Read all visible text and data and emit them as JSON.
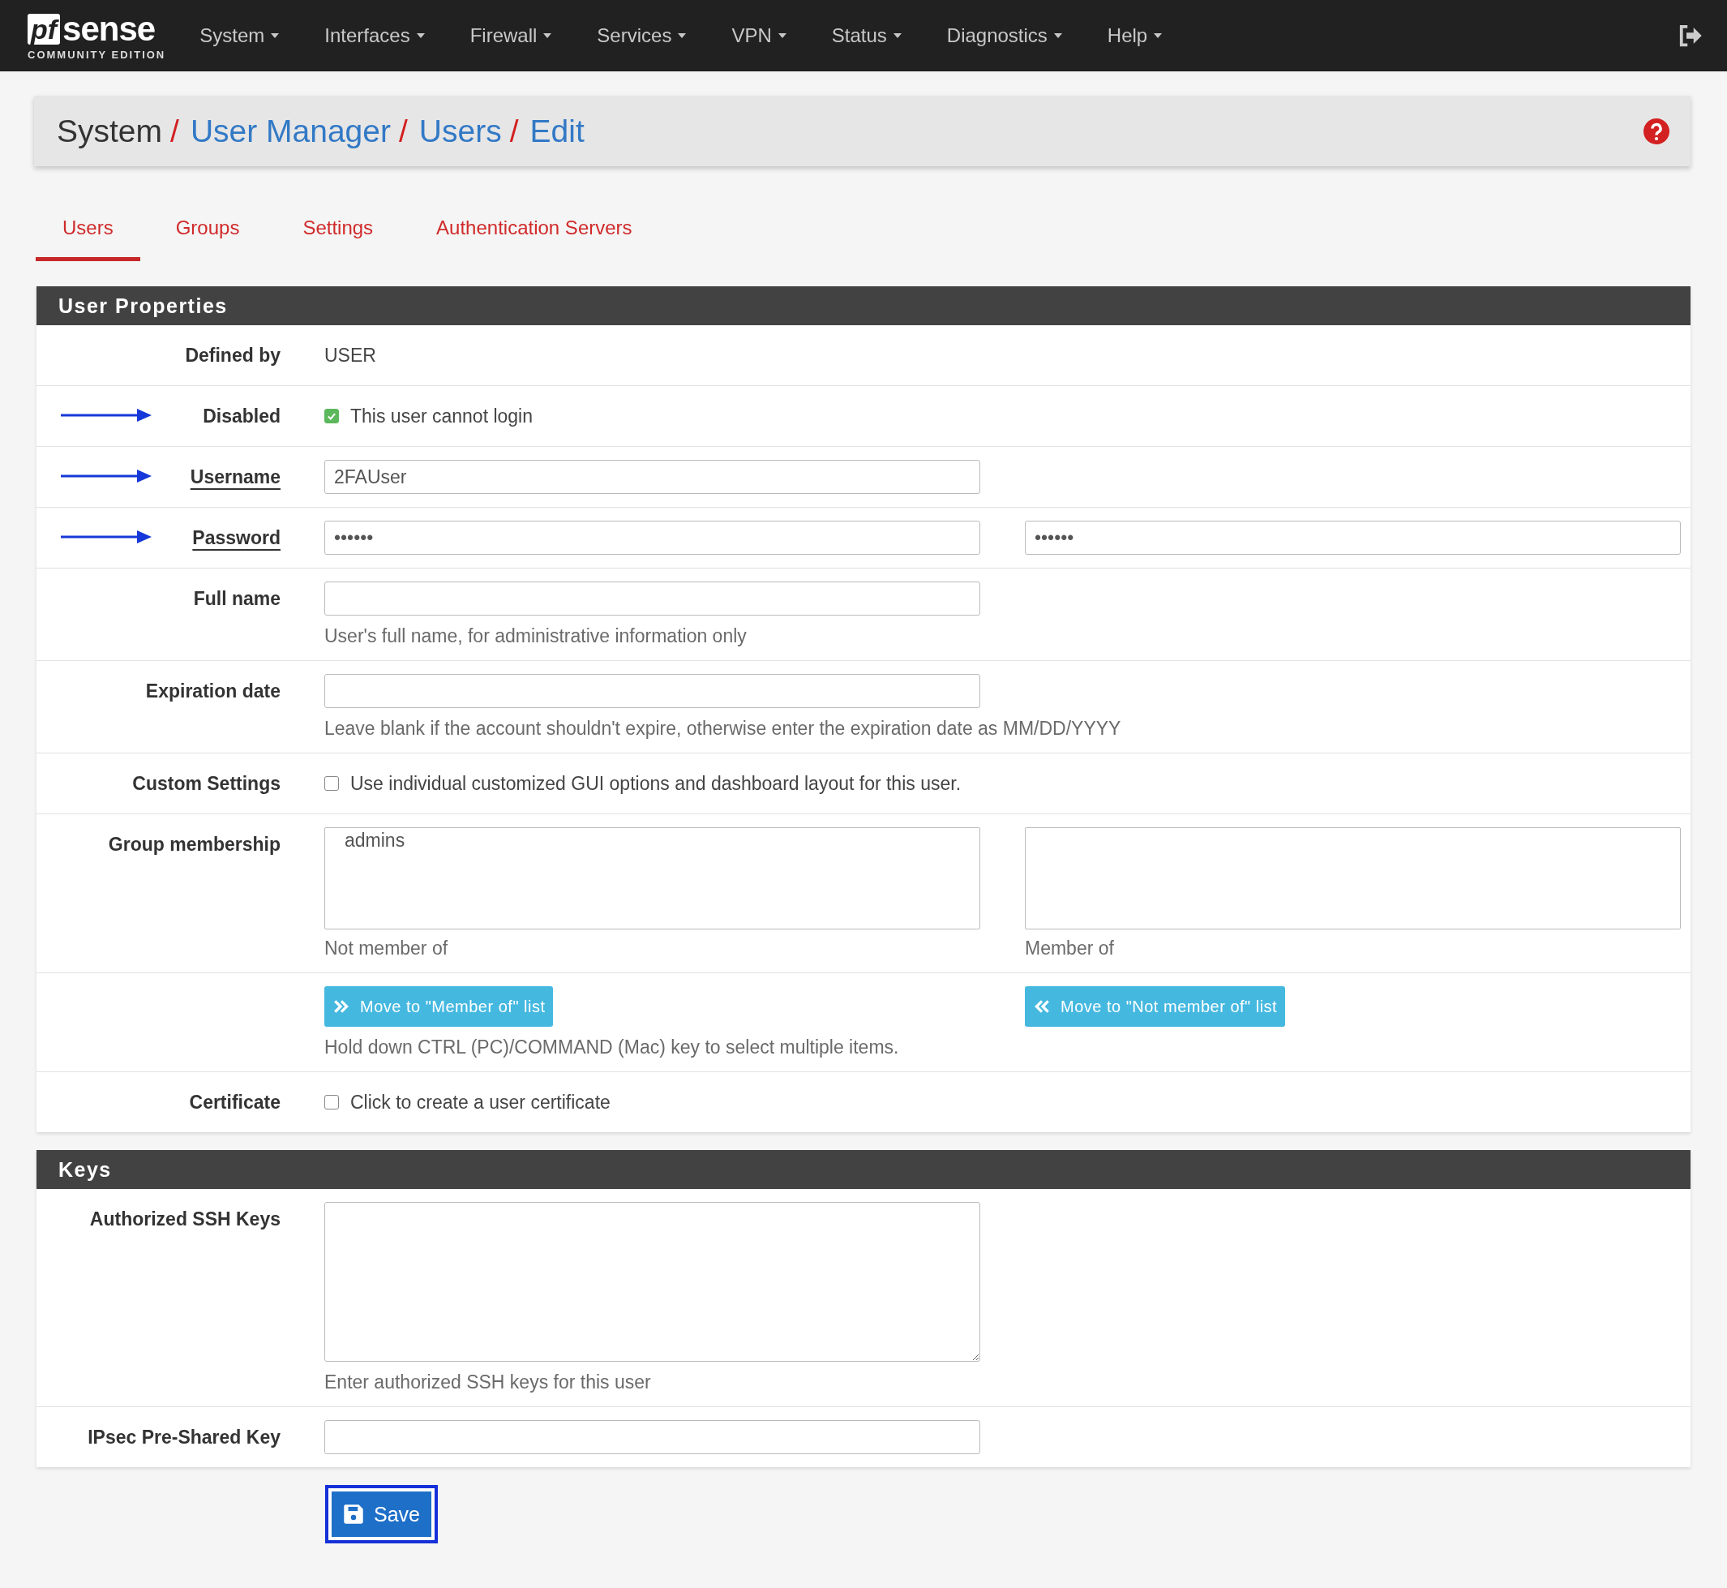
{
  "navbar": {
    "logo": {
      "mark": "pf",
      "word": "sense",
      "subtitle": "COMMUNITY EDITION"
    },
    "menus": [
      {
        "label": "System"
      },
      {
        "label": "Interfaces"
      },
      {
        "label": "Firewall"
      },
      {
        "label": "Services"
      },
      {
        "label": "VPN"
      },
      {
        "label": "Status"
      },
      {
        "label": "Diagnostics"
      },
      {
        "label": "Help"
      }
    ]
  },
  "breadcrumb": [
    {
      "label": "System",
      "link": false
    },
    {
      "separator": "/",
      "label": "User Manager",
      "link": true
    },
    {
      "separator": "/",
      "label": "Users",
      "link": true
    },
    {
      "separator": "/",
      "label": "Edit",
      "link": true
    }
  ],
  "tabs": [
    {
      "label": "Users",
      "selected": true
    },
    {
      "label": "Groups",
      "selected": false
    },
    {
      "label": "Settings",
      "selected": false
    },
    {
      "label": "Authentication Servers",
      "selected": false
    }
  ],
  "sections": [
    {
      "title": "User Properties",
      "rows": [
        {
          "kind": "static",
          "label": "Defined by",
          "value": "USER",
          "arrow": false,
          "required": false
        },
        {
          "kind": "checkbox",
          "label": "Disabled",
          "text": "This user cannot login",
          "checked": true,
          "arrow": true,
          "required": false
        },
        {
          "kind": "input",
          "label": "Username",
          "inputs": [
            {
              "kind": "textbox",
              "value": "2FAUser"
            }
          ],
          "arrow": true,
          "required": true
        },
        {
          "kind": "input",
          "label": "Password",
          "inputs": [
            {
              "kind": "textbox",
              "value": "••••••"
            },
            {
              "kind": "textbox",
              "value": "••••••"
            }
          ],
          "arrow": true,
          "required": true
        },
        {
          "kind": "input",
          "label": "Full name",
          "inputs": [
            {
              "kind": "textbox"
            }
          ],
          "help": "User's full name, for administrative information only",
          "arrow": false,
          "required": false
        },
        {
          "kind": "input",
          "label": "Expiration date",
          "inputs": [
            {
              "kind": "textbox"
            }
          ],
          "help": "Leave blank if the account shouldn't expire, otherwise enter the expiration date as MM/DD/YYYY",
          "arrow": false,
          "required": false
        },
        {
          "kind": "checkbox",
          "label": "Custom Settings",
          "text": "Use individual customized GUI options and dashboard layout for this user.",
          "checked": false,
          "arrow": false,
          "required": false
        },
        {
          "kind": "lists",
          "label": "Group membership",
          "lists": [
            {
              "items": [
                "admins"
              ],
              "caption": "Not member of"
            },
            {
              "caption": "Member of"
            }
          ],
          "arrow": false,
          "required": false
        },
        {
          "kind": "buttons",
          "buttons": [
            {
              "label": "Move to \"Member of\" list",
              "kind": "add"
            },
            {
              "label": "Move to \"Not member of\" list",
              "kind": "remove"
            }
          ],
          "help": "Hold down CTRL (PC)/COMMAND (Mac) key to select multiple items."
        },
        {
          "kind": "checkbox",
          "label": "Certificate",
          "text": "Click to create a user certificate",
          "checked": false,
          "arrow": false,
          "required": false
        }
      ]
    },
    {
      "title": "Keys",
      "rows": [
        {
          "kind": "textarea",
          "label": "Authorized SSH Keys",
          "help": "Enter authorized SSH keys for this user",
          "arrow": false,
          "required": false
        },
        {
          "kind": "input",
          "label": "IPsec Pre-Shared Key",
          "inputs": [
            {
              "kind": "textbox"
            }
          ],
          "arrow": false,
          "required": false
        }
      ]
    }
  ],
  "save_button": {
    "label": "Save",
    "focused": true
  }
}
